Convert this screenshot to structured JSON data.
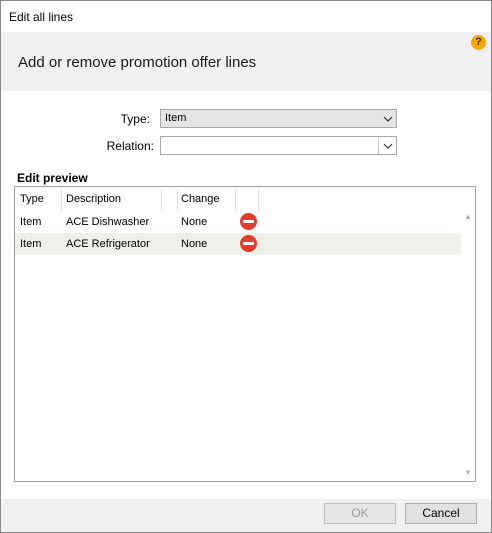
{
  "window": {
    "title": "Edit all lines"
  },
  "header": {
    "heading": "Add or remove promotion offer lines",
    "help_glyph": "?"
  },
  "form": {
    "type_label": "Type:",
    "type_value": "Item",
    "relation_label": "Relation:",
    "relation_value": ""
  },
  "preview": {
    "section_label": "Edit preview",
    "columns": [
      "Type",
      "Description",
      "Change"
    ],
    "rows": [
      {
        "type": "Item",
        "description": "ACE Dishwasher",
        "change": "None"
      },
      {
        "type": "Item",
        "description": "ACE Refrigerator",
        "change": "None"
      }
    ]
  },
  "footer": {
    "ok_label": "OK",
    "cancel_label": "Cancel"
  },
  "colors": {
    "remove_icon": "#e53c2a",
    "help_icon": "#f2a900",
    "alt_row": "#eef0ea"
  }
}
